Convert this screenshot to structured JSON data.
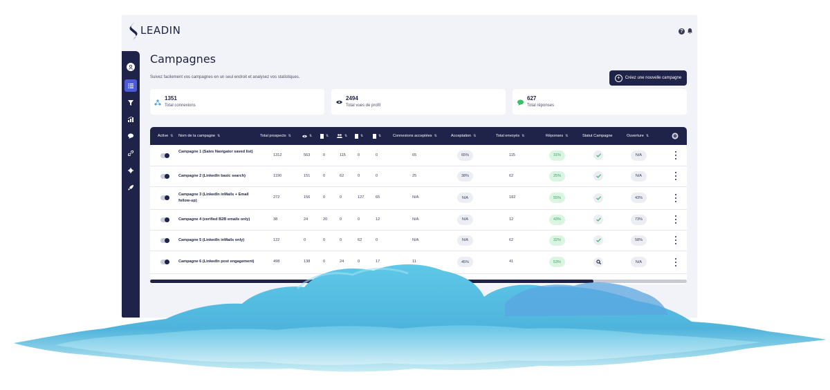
{
  "brand": {
    "name": "LEADIN"
  },
  "header": {
    "help_icon": "help-icon",
    "bell_icon": "bell-icon"
  },
  "sidebar": {
    "items": [
      {
        "name": "avatar",
        "icon": "user-icon"
      },
      {
        "name": "campaigns",
        "icon": "list-icon",
        "active": true
      },
      {
        "name": "filters",
        "icon": "funnel-icon"
      },
      {
        "name": "stats",
        "icon": "chart-icon"
      },
      {
        "name": "messages",
        "icon": "chat-icon"
      },
      {
        "name": "integrations",
        "icon": "link-icon"
      },
      {
        "name": "settings",
        "icon": "gear-icon"
      },
      {
        "name": "launch",
        "icon": "rocket-icon"
      }
    ]
  },
  "page": {
    "title": "Campagnes",
    "subtitle": "Suivez facilement vos campagnes en un seul endroit et analysez vos statistiques.",
    "new_campaign_label": "Créez une nouvelle campagne"
  },
  "stats": [
    {
      "value": "1351",
      "label": "Total connexions",
      "icon": "network-icon",
      "color": "#4aa8e8"
    },
    {
      "value": "2494",
      "label": "Total vues de profil",
      "icon": "eye-icon",
      "color": "#1d2140"
    },
    {
      "value": "627",
      "label": "Total réponses",
      "icon": "chat-bubble-icon",
      "color": "#3ac06a"
    }
  ],
  "table": {
    "headers": {
      "active": "Active",
      "name": "Nom de la campagne",
      "total_prospects": "Total prospects",
      "connexions_acceptees": "Connexions acceptées",
      "acceptation": "Acceptation",
      "total_envoyes": "Total envoyés",
      "reponses": "Réponses",
      "statut": "Statut Campagne",
      "ouverture": "Ouverture"
    },
    "rows": [
      {
        "name": "Campagne 1 (Sales Navigator saved list)",
        "prospects": "1312",
        "views": "563",
        "c1": "0",
        "c2": "115",
        "c3": "0",
        "c4": "0",
        "accepted": "65",
        "acceptation": "65%",
        "sent": "115",
        "replies": "31%",
        "status": "check",
        "opening": "N/A"
      },
      {
        "name": "Campagne 2 (LinkedIn basic search)",
        "prospects": "1190",
        "views": "151",
        "c1": "0",
        "c2": "62",
        "c3": "0",
        "c4": "0",
        "accepted": "25",
        "acceptation": "38%",
        "sent": "62",
        "replies": "25%",
        "status": "check",
        "opening": "N/A"
      },
      {
        "name": "Campagne 3 (LinkedIn inMails + Email follow-up)",
        "prospects": "272",
        "views": "156",
        "c1": "0",
        "c2": "0",
        "c3": "127",
        "c4": "65",
        "accepted": "N/A",
        "acceptation": "N/A",
        "sent": "182",
        "replies": "55%",
        "status": "check",
        "opening": "43%"
      },
      {
        "name": "Campagne 4 (verified B2B emails only)",
        "prospects": "38",
        "views": "24",
        "c1": "20",
        "c2": "0",
        "c3": "0",
        "c4": "12",
        "accepted": "N/A",
        "acceptation": "N/A",
        "sent": "12",
        "replies": "43%",
        "status": "check",
        "opening": "73%"
      },
      {
        "name": "Campagne 5 (LinkedIn inMails only)",
        "prospects": "122",
        "views": "0",
        "c1": "0",
        "c2": "0",
        "c3": "62",
        "c4": "0",
        "accepted": "N/A",
        "acceptation": "N/A",
        "sent": "62",
        "replies": "32%",
        "status": "check",
        "opening": "58%"
      },
      {
        "name": "Campagne 6 (LinkedIn post engagement)",
        "prospects": "498",
        "views": "138",
        "c1": "0",
        "c2": "24",
        "c3": "0",
        "c4": "17",
        "accepted": "11",
        "acceptation": "45%",
        "sent": "41",
        "replies": "53%",
        "status": "search",
        "opening": "N/A"
      }
    ]
  },
  "colors": {
    "navy": "#1f2249",
    "accent": "#4a5ad8",
    "green": "#3aa36a",
    "cloud": "#5ec3e4"
  }
}
